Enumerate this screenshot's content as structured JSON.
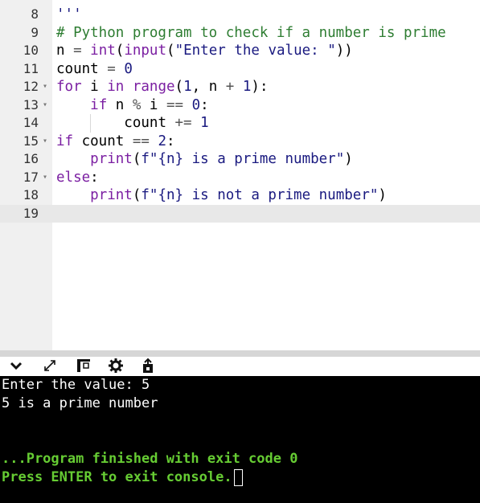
{
  "editor": {
    "lines": [
      {
        "num": "8",
        "fold": false,
        "indent": "",
        "tokens": [
          {
            "t": "'''",
            "c": "str"
          }
        ]
      },
      {
        "num": "9",
        "fold": false,
        "indent": "",
        "tokens": [
          {
            "t": "# Python program to check if a number is prime",
            "c": "cmt"
          }
        ]
      },
      {
        "num": "10",
        "fold": false,
        "indent": "",
        "tokens": [
          {
            "t": "n ",
            "c": ""
          },
          {
            "t": "=",
            "c": "op"
          },
          {
            "t": " ",
            "c": ""
          },
          {
            "t": "int",
            "c": "fn"
          },
          {
            "t": "(",
            "c": ""
          },
          {
            "t": "input",
            "c": "fn"
          },
          {
            "t": "(",
            "c": ""
          },
          {
            "t": "\"Enter the value: \"",
            "c": "str"
          },
          {
            "t": "))",
            "c": ""
          }
        ]
      },
      {
        "num": "11",
        "fold": false,
        "indent": "",
        "tokens": [
          {
            "t": "count ",
            "c": ""
          },
          {
            "t": "=",
            "c": "op"
          },
          {
            "t": " ",
            "c": ""
          },
          {
            "t": "0",
            "c": "num"
          }
        ]
      },
      {
        "num": "12",
        "fold": true,
        "indent": "",
        "tokens": [
          {
            "t": "for",
            "c": "kw"
          },
          {
            "t": " i ",
            "c": ""
          },
          {
            "t": "in",
            "c": "kw"
          },
          {
            "t": " ",
            "c": ""
          },
          {
            "t": "range",
            "c": "fn"
          },
          {
            "t": "(",
            "c": ""
          },
          {
            "t": "1",
            "c": "num"
          },
          {
            "t": ", n ",
            "c": ""
          },
          {
            "t": "+",
            "c": "op"
          },
          {
            "t": " ",
            "c": ""
          },
          {
            "t": "1",
            "c": "num"
          },
          {
            "t": "):",
            "c": ""
          }
        ]
      },
      {
        "num": "13",
        "fold": true,
        "indent": "    ",
        "tokens": [
          {
            "t": "if",
            "c": "kw"
          },
          {
            "t": " n ",
            "c": ""
          },
          {
            "t": "%",
            "c": "op"
          },
          {
            "t": " i ",
            "c": ""
          },
          {
            "t": "==",
            "c": "op"
          },
          {
            "t": " ",
            "c": ""
          },
          {
            "t": "0",
            "c": "num"
          },
          {
            "t": ":",
            "c": ""
          }
        ]
      },
      {
        "num": "14",
        "fold": false,
        "indent": "        ",
        "tokens": [
          {
            "t": "count ",
            "c": ""
          },
          {
            "t": "+=",
            "c": "op"
          },
          {
            "t": " ",
            "c": ""
          },
          {
            "t": "1",
            "c": "num"
          }
        ]
      },
      {
        "num": "15",
        "fold": true,
        "indent": "",
        "tokens": [
          {
            "t": "if",
            "c": "kw"
          },
          {
            "t": " count ",
            "c": ""
          },
          {
            "t": "==",
            "c": "op"
          },
          {
            "t": " ",
            "c": ""
          },
          {
            "t": "2",
            "c": "num"
          },
          {
            "t": ":",
            "c": ""
          }
        ]
      },
      {
        "num": "16",
        "fold": false,
        "indent": "    ",
        "tokens": [
          {
            "t": "print",
            "c": "fn"
          },
          {
            "t": "(",
            "c": ""
          },
          {
            "t": "f\"{n} is a prime number\"",
            "c": "str"
          },
          {
            "t": ")",
            "c": ""
          }
        ]
      },
      {
        "num": "17",
        "fold": true,
        "indent": "",
        "tokens": [
          {
            "t": "else",
            "c": "kw"
          },
          {
            "t": ":",
            "c": ""
          }
        ]
      },
      {
        "num": "18",
        "fold": false,
        "indent": "    ",
        "tokens": [
          {
            "t": "print",
            "c": "fn"
          },
          {
            "t": "(",
            "c": ""
          },
          {
            "t": "f\"{n} is not a prime number\"",
            "c": "str"
          },
          {
            "t": ")",
            "c": ""
          }
        ]
      },
      {
        "num": "19",
        "fold": false,
        "indent": "",
        "tokens": [],
        "active": true
      }
    ]
  },
  "toolbar": {
    "icons": [
      "chevron-down-icon",
      "expand-icon",
      "copy-icon",
      "settings-gear-icon",
      "stdin-upload-icon"
    ]
  },
  "console": {
    "prompt_line": "Enter the value: 5",
    "result_line": "5 is a prime number",
    "finished_line": "...Program finished with exit code 0",
    "exit_line": "Press ENTER to exit console."
  },
  "colors": {
    "keyword": "#7b1fa2",
    "string": "#1a1a80",
    "comment": "#2e7d32",
    "console_bg": "#000000",
    "console_green": "#66cc33"
  }
}
